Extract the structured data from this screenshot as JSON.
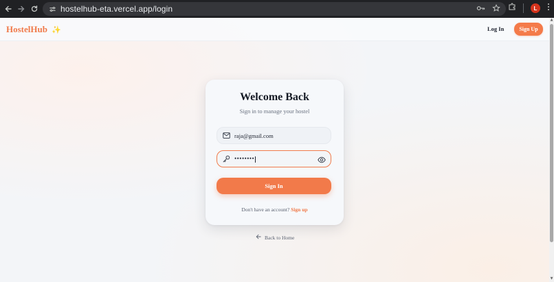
{
  "browser": {
    "url": "hostelhub-eta.vercel.app/login",
    "profile_initial": "L"
  },
  "header": {
    "brand": "HostelHub",
    "brand_emoji": "✨",
    "login_label": "Log In",
    "signup_label": "Sign Up"
  },
  "card": {
    "title": "Welcome Back",
    "subtitle": "Sign in to manage your hostel",
    "email_value": "raja@gmail.com",
    "password_value": "••••••••",
    "signin_label": "Sign In",
    "no_account_text": "Don't have an account?",
    "signup_link": "Sign up"
  },
  "footer": {
    "back_home_label": "Back to Home"
  },
  "colors": {
    "accent": "#f27a4a",
    "chrome_bg": "#202124",
    "page_bg": "#f3f5f8"
  }
}
